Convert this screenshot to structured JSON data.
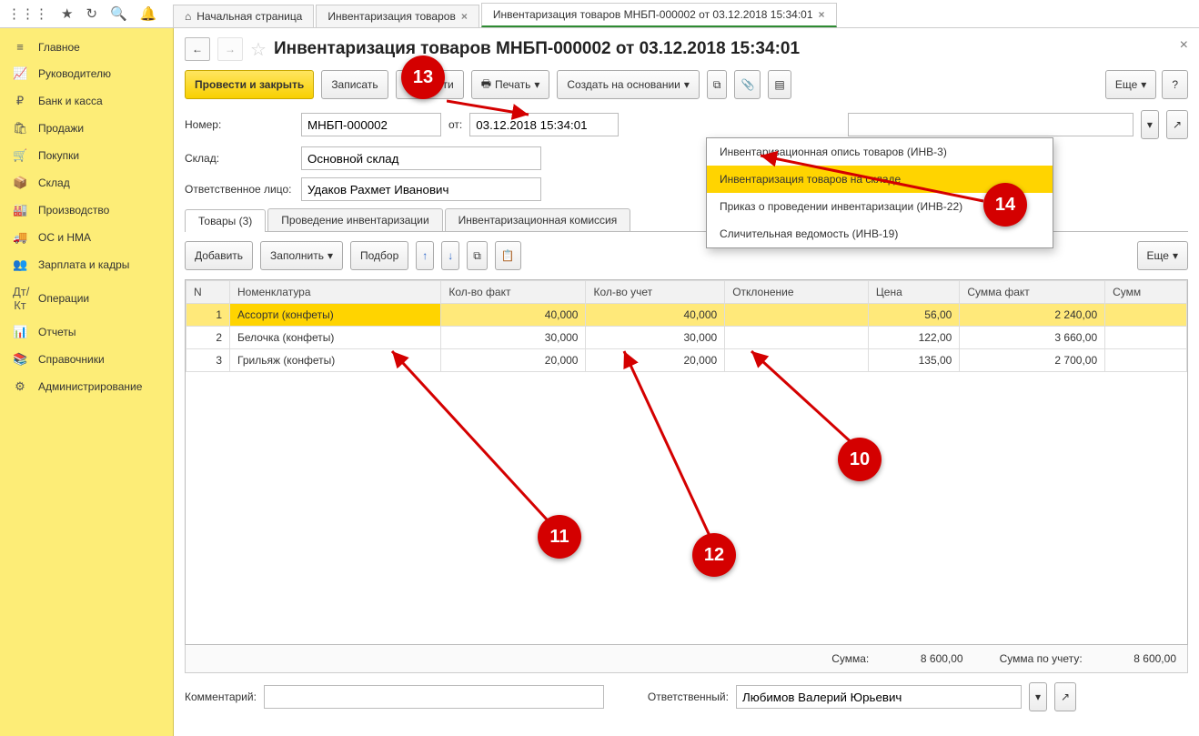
{
  "top_icons": [
    "⋮⋮⋮",
    "★",
    "↻",
    "🔍",
    "🔔"
  ],
  "tabs": [
    {
      "icon": "⌂",
      "label": "Начальная страница",
      "closable": false
    },
    {
      "label": "Инвентаризация товаров",
      "closable": true
    },
    {
      "label": "Инвентаризация товаров МНБП-000002 от 03.12.2018 15:34:01",
      "closable": true,
      "active": true
    }
  ],
  "sidebar": [
    {
      "icon": "≡",
      "label": "Главное"
    },
    {
      "icon": "📈",
      "label": "Руководителю"
    },
    {
      "icon": "₽",
      "label": "Банк и касса"
    },
    {
      "icon": "🛍",
      "label": "Продажи"
    },
    {
      "icon": "🛒",
      "label": "Покупки"
    },
    {
      "icon": "📦",
      "label": "Склад"
    },
    {
      "icon": "🏭",
      "label": "Производство"
    },
    {
      "icon": "🚚",
      "label": "ОС и НМА"
    },
    {
      "icon": "👥",
      "label": "Зарплата и кадры"
    },
    {
      "icon": "Дт/Кт",
      "label": "Операции"
    },
    {
      "icon": "📊",
      "label": "Отчеты"
    },
    {
      "icon": "📚",
      "label": "Справочники"
    },
    {
      "icon": "⚙",
      "label": "Администрирование"
    }
  ],
  "page_title": "Инвентаризация товаров МНБП-000002 от 03.12.2018 15:34:01",
  "toolbar": {
    "primary": "Провести и закрыть",
    "save": "Записать",
    "post": "Провести",
    "print": "Печать",
    "create_based": "Создать на основании",
    "more": "Еще",
    "help": "?"
  },
  "fields": {
    "number_label": "Номер:",
    "number_value": "МНБП-000002",
    "from_label": "от:",
    "date_value": "03.12.2018 15:34:01",
    "warehouse_label": "Склад:",
    "warehouse_value": "Основной склад",
    "responsible_label": "Ответственное лицо:",
    "responsible_value": "Удаков Рахмет Иванович"
  },
  "subtabs": [
    "Товары (3)",
    "Проведение инвентаризации",
    "Инвентаризационная комиссия"
  ],
  "grid_toolbar": {
    "add": "Добавить",
    "fill": "Заполнить",
    "pick": "Подбор",
    "more": "Еще"
  },
  "columns": [
    "N",
    "Номенклатура",
    "Кол-во факт",
    "Кол-во учет",
    "Отклонение",
    "Цена",
    "Сумма факт",
    "Сумм"
  ],
  "rows": [
    {
      "n": "1",
      "nomen": "Ассорти (конфеты)",
      "fact": "40,000",
      "acct": "40,000",
      "dev": "",
      "price": "56,00",
      "sumfact": "2 240,00",
      "selected": true
    },
    {
      "n": "2",
      "nomen": "Белочка (конфеты)",
      "fact": "30,000",
      "acct": "30,000",
      "dev": "",
      "price": "122,00",
      "sumfact": "3 660,00"
    },
    {
      "n": "3",
      "nomen": "Грильяж (конфеты)",
      "fact": "20,000",
      "acct": "20,000",
      "dev": "",
      "price": "135,00",
      "sumfact": "2 700,00"
    }
  ],
  "totals": {
    "sum_label": "Сумма:",
    "sum_val": "8 600,00",
    "acct_label": "Сумма по учету:",
    "acct_val": "8 600,00"
  },
  "comment": {
    "label": "Комментарий:",
    "value": "",
    "resp_label": "Ответственный:",
    "resp_value": "Любимов Валерий Юрьевич"
  },
  "dropdown": [
    "Инвентаризационная опись товаров (ИНВ-3)",
    "Инвентаризация товаров на складе",
    "Приказ о проведении инвентаризации (ИНВ-22)",
    "Сличительная ведомость (ИНВ-19)"
  ],
  "dropdown_hl_index": 1,
  "callouts": {
    "10": "10",
    "11": "11",
    "12": "12",
    "13": "13",
    "14": "14"
  }
}
